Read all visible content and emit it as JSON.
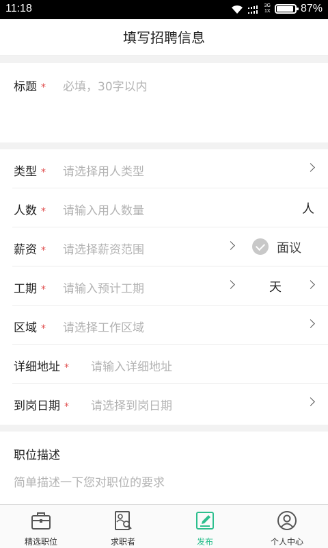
{
  "status_bar": {
    "time": "11:18",
    "network_top": "3G",
    "network_bottom": "1X",
    "battery": "87%",
    "battery_level": 0.87
  },
  "header": {
    "title": "填写招聘信息"
  },
  "form": {
    "title": {
      "label": "标题",
      "required_mark": "*",
      "placeholder": "必填，30字以内"
    },
    "type": {
      "label": "类型",
      "required_mark": "*",
      "placeholder": "请选择用人类型"
    },
    "count": {
      "label": "人数",
      "required_mark": "*",
      "placeholder": "请输入用人数量",
      "unit": "人"
    },
    "salary": {
      "label": "薪资",
      "required_mark": "*",
      "placeholder": "请选择薪资范围",
      "negotiable_label": "面议"
    },
    "duration": {
      "label": "工期",
      "required_mark": "*",
      "placeholder": "请输入预计工期",
      "unit": "天"
    },
    "area": {
      "label": "区域",
      "required_mark": "*",
      "placeholder": "请选择工作区域"
    },
    "address": {
      "label": "详细地址",
      "required_mark": "*",
      "placeholder": "请输入详细地址"
    },
    "start_date": {
      "label": "到岗日期",
      "required_mark": "*",
      "placeholder": "请选择到岗日期"
    },
    "description": {
      "label": "职位描述",
      "placeholder": "简单描述一下您对职位的要求"
    }
  },
  "tabbar": {
    "tabs": [
      {
        "label": "精选职位",
        "icon": "briefcase-icon"
      },
      {
        "label": "求职者",
        "icon": "resume-search-icon"
      },
      {
        "label": "发布",
        "icon": "edit-icon"
      },
      {
        "label": "个人中心",
        "icon": "user-icon"
      }
    ],
    "active_index": 2,
    "active_color": "#2dbf8e"
  }
}
